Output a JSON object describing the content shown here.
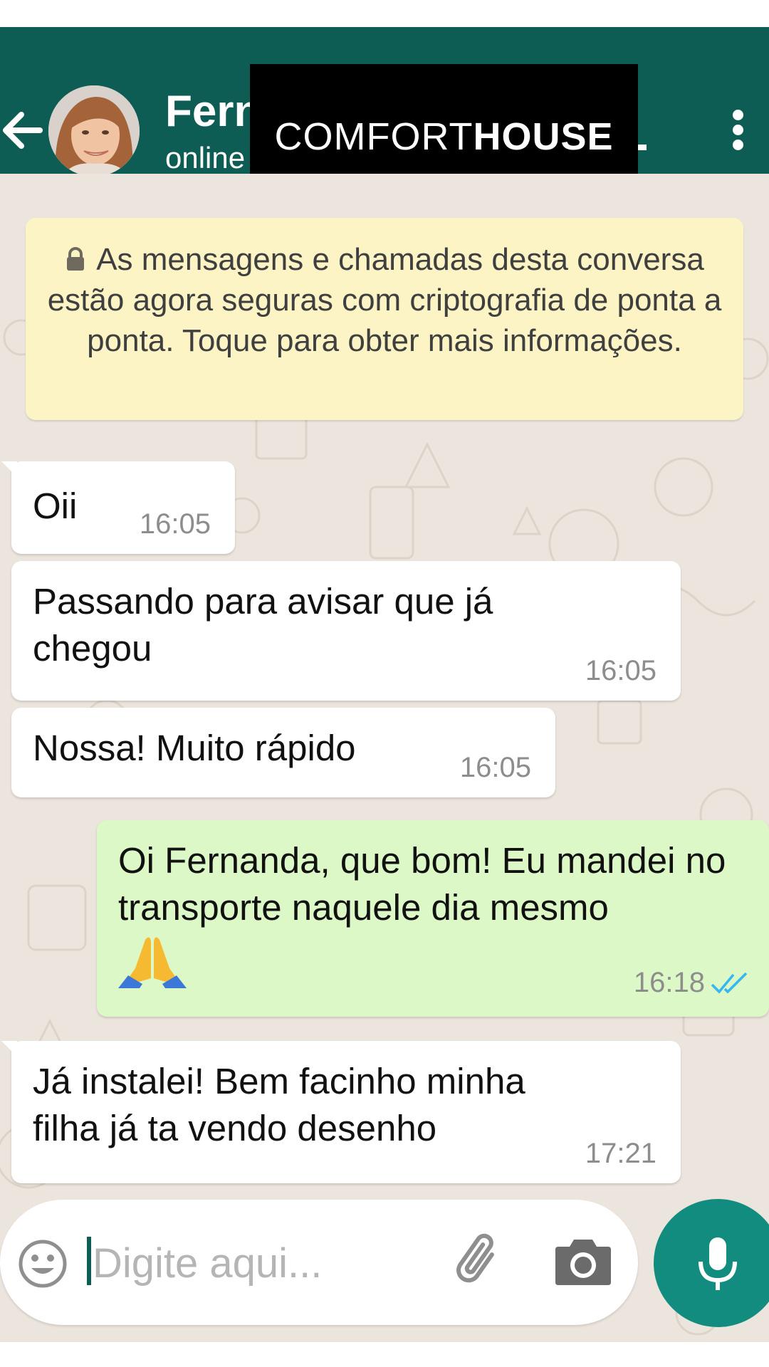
{
  "header": {
    "contact_name": "Fern",
    "status": "online",
    "back_icon": "arrow-left-icon",
    "menu_icon": "more-vertical-icon",
    "color": "#0e5d55"
  },
  "logo": {
    "part1": "COMFORT",
    "part2": "HOUSE"
  },
  "notice": {
    "text": "As mensagens e chamadas desta conversa estão agora seguras com criptografia de ponta a ponta. Toque para obter mais informações.",
    "icon": "lock-icon"
  },
  "messages": [
    {
      "direction": "in",
      "text": "Oii",
      "time": "16:05"
    },
    {
      "direction": "in",
      "text": "Passando para avisar que já chegou",
      "time": "16:05"
    },
    {
      "direction": "in",
      "text": "Nossa! Muito rápido",
      "time": "16:05"
    },
    {
      "direction": "out",
      "text": "Oi Fernanda, que bom! Eu mandei no transporte naquele dia mesmo",
      "emoji": "folded-hands-emoji",
      "time": "16:18",
      "status": "read"
    },
    {
      "direction": "in",
      "text": "Já instalei! Bem facinho minha filha já ta vendo desenho",
      "time": "17:21"
    }
  ],
  "composer": {
    "placeholder": "Digite aqui...",
    "emoji_icon": "smiley-icon",
    "attach_icon": "paperclip-icon",
    "camera_icon": "camera-icon",
    "mic_icon": "mic-icon",
    "accent": "#128c7e"
  }
}
